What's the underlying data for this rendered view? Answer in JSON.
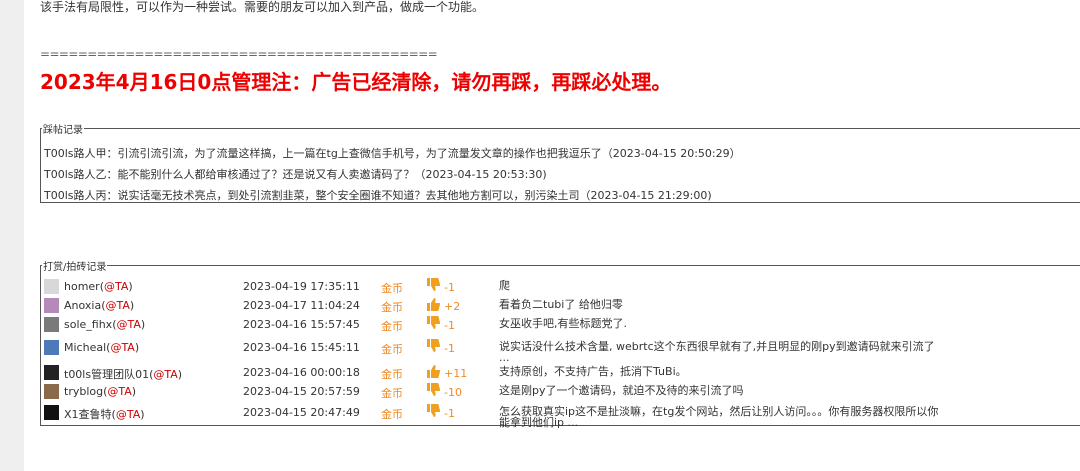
{
  "intro": "该手法有局限性，可以作为一种尝试。需要的朋友可以加入到产品，做成一个功能。",
  "separator": "==========================================",
  "notice": "2023年4月16日0点管理注：广告已经清除，请勿再踩，再踩必处理。",
  "trample": {
    "legend": "踩帖记录",
    "lines": [
      "T00ls路人甲：引流引流引流，为了流量这样搞，上一篇在tg上查微信手机号，为了流量发文章的操作也把我逗乐了（2023-04-15 20:50:29）",
      "T00ls路人乙：能不能别什么人都给审核通过了？还是说又有人卖邀请码了？（2023-04-15 20:53:30)",
      "T00ls路人丙：说实话毫无技术亮点，到处引流割韭菜，整个安全圈谁不知道？去其他地方割可以，别污染土司（2023-04-15 21:29:00)"
    ]
  },
  "rewards": {
    "legend": "打赏/拍砖记录",
    "currency": "金币",
    "at_label": "@TA",
    "rows": [
      {
        "user": "homer",
        "date": "2023-04-19 17:35:11",
        "score": "-1",
        "thumb": "down",
        "reason": "爬",
        "avatar": "homer-avatar"
      },
      {
        "user": "Anoxia",
        "date": "2023-04-17 11:04:24",
        "score": "+2",
        "thumb": "up",
        "reason": "看着负二tubi了 给他归零",
        "avatar": "anoxia-avatar"
      },
      {
        "user": "sole_fihx",
        "date": "2023-04-16 15:57:45",
        "score": "-1",
        "thumb": "down",
        "reason": "女巫收手吧,有些标题党了.",
        "avatar": "sole-fihx-avatar"
      },
      {
        "user": "Micheal",
        "date": "2023-04-16 15:45:11",
        "score": "-1",
        "thumb": "down",
        "reason": "说实话没什么技术含量, webrtc这个东西很早就有了,并且明显的刚py到邀请码就来引流了 ...",
        "avatar": "micheal-avatar"
      },
      {
        "user": "t00ls管理团队01",
        "date": "2023-04-16 00:00:18",
        "score": "+11",
        "thumb": "up",
        "reason": "支持原创，不支持广告，抵消下TuBi。",
        "avatar": "t00ls-avatar"
      },
      {
        "user": "tryblog",
        "date": "2023-04-15 20:57:59",
        "score": "-10",
        "thumb": "down",
        "reason": "这是刚py了一个邀请码，就迫不及待的来引流了吗",
        "avatar": "tryblog-avatar"
      },
      {
        "user": "X1查鲁特",
        "date": "2023-04-15 20:47:49",
        "score": "-1",
        "thumb": "down",
        "reason": "怎么获取真实ip这不是扯淡嘛，在tg发个网站，然后让别人访问。。。你有服务器权限所以你能拿到他们ip ...",
        "avatar": "x1-avatar"
      }
    ]
  },
  "colors": {
    "notice": "#ee0000",
    "at": "#cc0000",
    "coin": "#f08a24",
    "thumb": "#f0a020"
  }
}
